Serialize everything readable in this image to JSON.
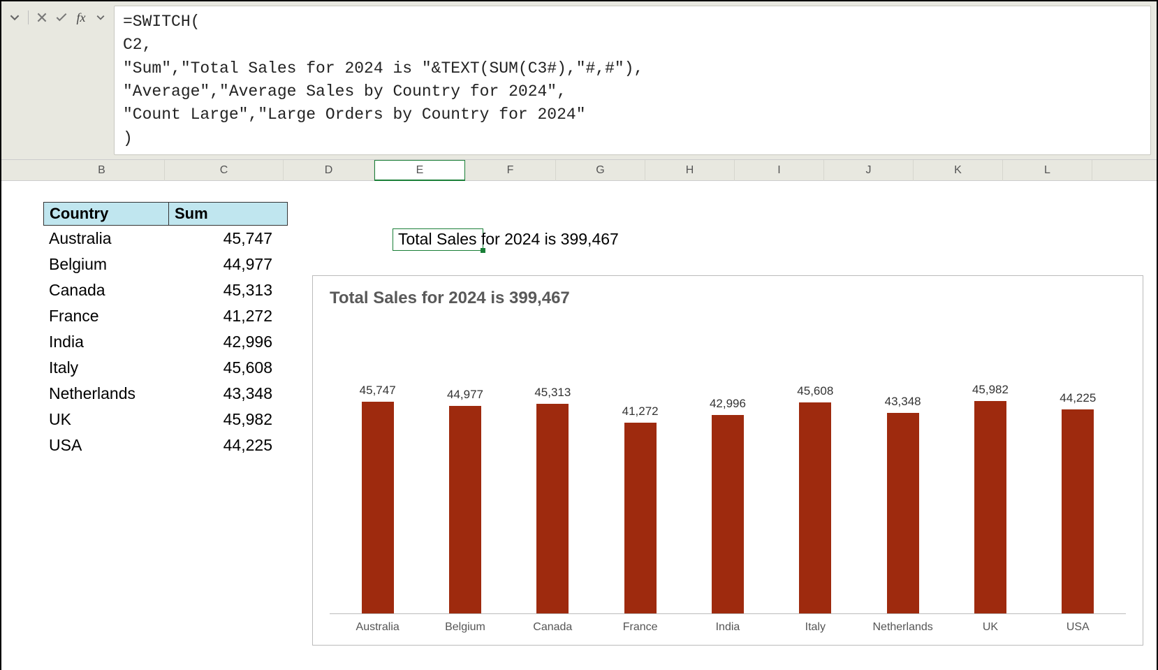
{
  "formula_bar": {
    "formula": "=SWITCH(\nC2,\n\"Sum\",\"Total Sales for 2024 is \"&TEXT(SUM(C3#),\"#,#\"),\n\"Average\",\"Average Sales by Country for 2024\",\n\"Count Large\",\"Large Orders by Country for 2024\"\n)"
  },
  "column_headers": [
    "B",
    "C",
    "D",
    "E",
    "F",
    "G",
    "H",
    "I",
    "J",
    "K",
    "L"
  ],
  "active_column": "E",
  "table": {
    "header_country": "Country",
    "header_agg": "Sum",
    "rows": [
      {
        "country": "Australia",
        "value": "45,747"
      },
      {
        "country": "Belgium",
        "value": "44,977"
      },
      {
        "country": "Canada",
        "value": "45,313"
      },
      {
        "country": "France",
        "value": "41,272"
      },
      {
        "country": "India",
        "value": "42,996"
      },
      {
        "country": "Italy",
        "value": "45,608"
      },
      {
        "country": "Netherlands",
        "value": "43,348"
      },
      {
        "country": "UK",
        "value": "45,982"
      },
      {
        "country": "USA",
        "value": "44,225"
      }
    ]
  },
  "result_cell_text": "Total Sales for 2024 is 399,467",
  "chart_data": {
    "type": "bar",
    "title": "Total Sales for 2024 is 399,467",
    "categories": [
      "Australia",
      "Belgium",
      "Canada",
      "France",
      "India",
      "Italy",
      "Netherlands",
      "UK",
      "USA"
    ],
    "values": [
      45747,
      44977,
      45313,
      41272,
      42996,
      45608,
      43348,
      45982,
      44225
    ],
    "value_labels": [
      "45,747",
      "44,977",
      "45,313",
      "41,272",
      "42,996",
      "45,608",
      "43,348",
      "45,982",
      "44,225"
    ],
    "xlabel": "",
    "ylabel": "",
    "ylim": [
      0,
      46000
    ],
    "bar_color": "#9e2a0e"
  },
  "col_widths": {
    "row_gutter": 54,
    "B": 180,
    "C": 170,
    "D": 130,
    "E": 130,
    "F": 130,
    "G": 128,
    "H": 128,
    "I": 128,
    "J": 128,
    "K": 128,
    "L": 128
  }
}
